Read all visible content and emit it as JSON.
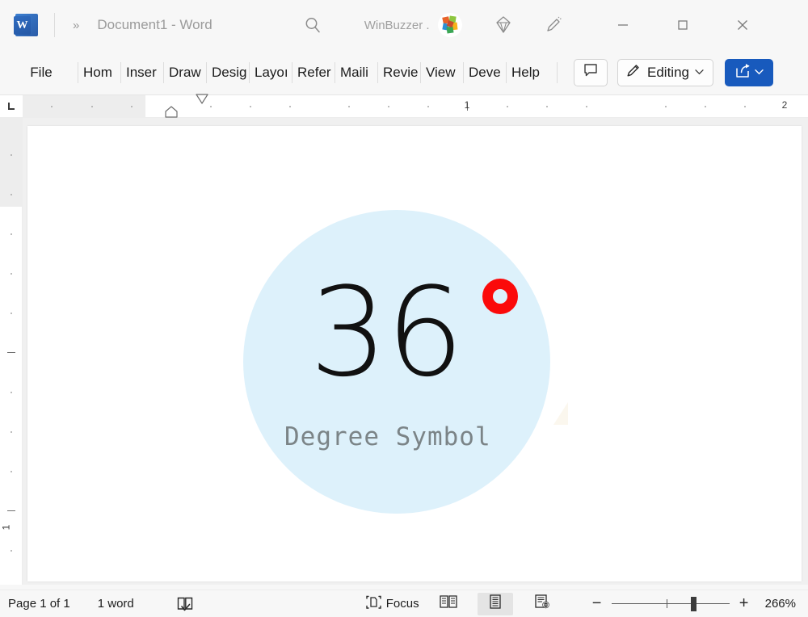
{
  "titlebar": {
    "app_logo": "word-logo",
    "chevrons": "»",
    "document_title": "Document1  -  Word",
    "search_icon": "search-icon",
    "user_name": "WinBuzzer .",
    "avatar": "user-avatar",
    "gem_icon": "diamond-icon",
    "pen_icon": "pen-icon",
    "minimize": "–",
    "maximize": "□",
    "close": "✕"
  },
  "ribbon": {
    "tabs": [
      {
        "label": "File"
      },
      {
        "label": "Hom"
      },
      {
        "label": "Inser"
      },
      {
        "label": "Draw"
      },
      {
        "label": "Desiɡ"
      },
      {
        "label": "Layoı"
      },
      {
        "label": "Refer"
      },
      {
        "label": "Maili"
      },
      {
        "label": "Revie"
      },
      {
        "label": "View"
      },
      {
        "label": "Deve"
      },
      {
        "label": "Help"
      }
    ],
    "comment_button": "comment-icon",
    "editing_label": "Editing",
    "editing_caret": "⌄",
    "editing_icon": "pencil-icon",
    "share_icon": "share-icon",
    "share_caret": "⌄",
    "share_color": "#185abd"
  },
  "ruler": {
    "corner_marker": "tab-stop-left",
    "horizontal_numbers": [
      "1",
      "2"
    ],
    "vertical_numbers": [
      "1"
    ],
    "indent_top_marker": "first-line-indent",
    "indent_bottom_marker": "left-indent"
  },
  "document": {
    "number": "36",
    "degree_symbol": "°",
    "degree_color": "#fb0a0a",
    "caption": "Degree Symbol",
    "caption_color": "#7b8487",
    "circle_color": "#ddf1fb"
  },
  "statusbar": {
    "page_count": "Page 1 of 1",
    "word_count": "1 word",
    "proofing_icon": "proofing-icon",
    "focus_icon": "focus-icon",
    "focus_label": "Focus",
    "read_mode_icon": "read-mode-icon",
    "print_layout_icon": "print-layout-icon",
    "web_layout_icon": "web-layout-icon",
    "zoom_out": "−",
    "zoom_in": "+",
    "zoom_level": "266%"
  }
}
